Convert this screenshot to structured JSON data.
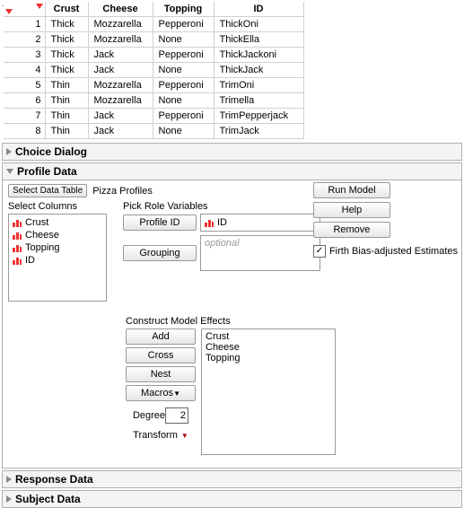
{
  "table": {
    "headers": {
      "crust": "Crust",
      "cheese": "Cheese",
      "topping": "Topping",
      "id": "ID"
    },
    "rows": [
      {
        "n": "1",
        "crust": "Thick",
        "cheese": "Mozzarella",
        "topping": "Pepperoni",
        "id": "ThickOni"
      },
      {
        "n": "2",
        "crust": "Thick",
        "cheese": "Mozzarella",
        "topping": "None",
        "id": "ThickElla"
      },
      {
        "n": "3",
        "crust": "Thick",
        "cheese": "Jack",
        "topping": "Pepperoni",
        "id": "ThickJackoni"
      },
      {
        "n": "4",
        "crust": "Thick",
        "cheese": "Jack",
        "topping": "None",
        "id": "ThickJack"
      },
      {
        "n": "5",
        "crust": "Thin",
        "cheese": "Mozzarella",
        "topping": "Pepperoni",
        "id": "TrimOni"
      },
      {
        "n": "6",
        "crust": "Thin",
        "cheese": "Mozzarella",
        "topping": "None",
        "id": "Trimella"
      },
      {
        "n": "7",
        "crust": "Thin",
        "cheese": "Jack",
        "topping": "Pepperoni",
        "id": "TrimPepperjack"
      },
      {
        "n": "8",
        "crust": "Thin",
        "cheese": "Jack",
        "topping": "None",
        "id": "TrimJack"
      }
    ]
  },
  "sections": {
    "choice_dialog": "Choice Dialog",
    "profile_data": "Profile Data",
    "response_data": "Response Data",
    "subject_data": "Subject Data"
  },
  "profile": {
    "select_data_table_btn": "Select Data Table",
    "table_name": "Pizza Profiles",
    "select_columns_label": "Select Columns",
    "columns": [
      "Crust",
      "Cheese",
      "Topping",
      "ID"
    ],
    "pick_role_label": "Pick Role Variables",
    "profile_id_btn": "Profile ID",
    "profile_id_value": "ID",
    "grouping_btn": "Grouping",
    "grouping_placeholder": "optional",
    "construct_label": "Construct Model Effects",
    "add_btn": "Add",
    "cross_btn": "Cross",
    "nest_btn": "Nest",
    "macros_btn": "Macros",
    "degree_label": "Degree",
    "degree_value": "2",
    "transform_label": "Transform",
    "effects": [
      "Crust",
      "Cheese",
      "Topping"
    ]
  },
  "right_panel": {
    "run_model": "Run Model",
    "help": "Help",
    "remove": "Remove",
    "firth_label": "Firth Bias-adjusted Estimates",
    "firth_checked": "✓"
  }
}
